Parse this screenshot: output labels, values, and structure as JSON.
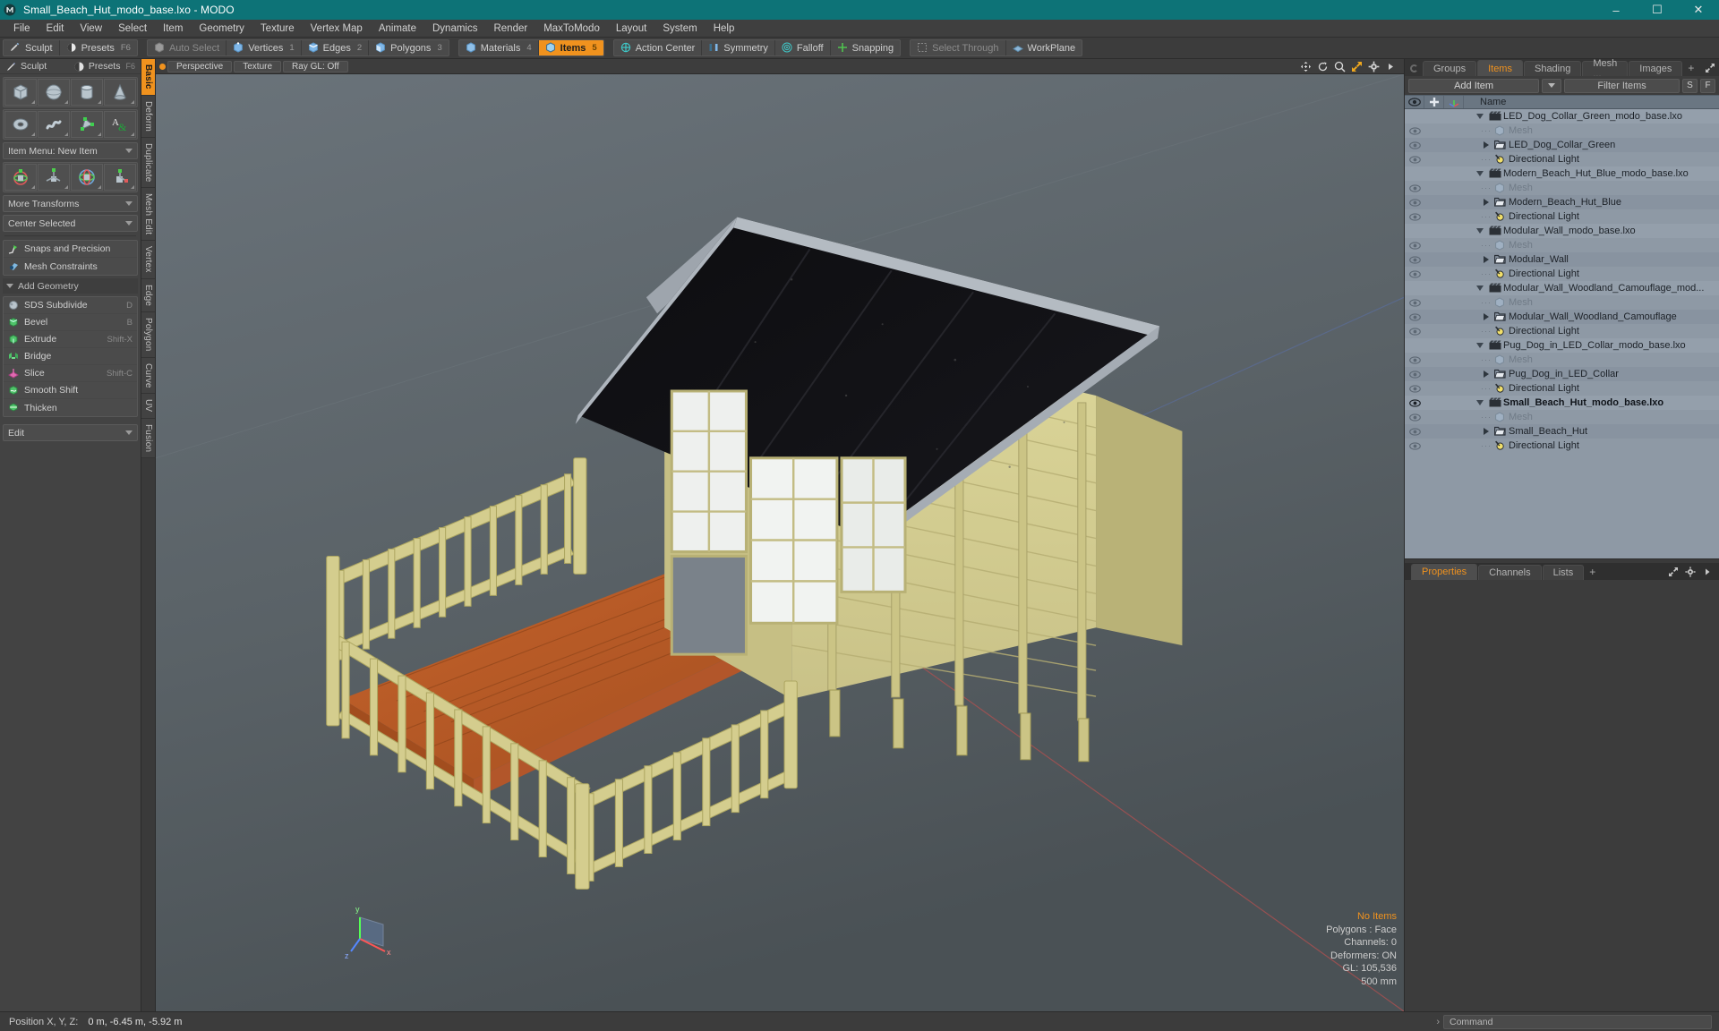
{
  "titlebar": {
    "title": "Small_Beach_Hut_modo_base.lxo - MODO",
    "minimize": "–",
    "maximize": "☐",
    "close": "✕"
  },
  "menubar": {
    "items": [
      "File",
      "Edit",
      "View",
      "Select",
      "Item",
      "Geometry",
      "Texture",
      "Vertex Map",
      "Animate",
      "Dynamics",
      "Render",
      "MaxToModo",
      "Layout",
      "System",
      "Help"
    ]
  },
  "modebar": {
    "group1": [
      {
        "label": "Sculpt",
        "icon": "sculpt-icon",
        "state": "normal",
        "num": ""
      },
      {
        "label": "Presets",
        "icon": "presets-icon",
        "state": "normal",
        "num": "F6"
      }
    ],
    "group2": [
      {
        "label": "Auto Select",
        "icon": "auto-select-icon",
        "state": "dim",
        "num": ""
      },
      {
        "label": "Vertices",
        "icon": "vertices-icon",
        "state": "normal",
        "num": "1"
      },
      {
        "label": "Edges",
        "icon": "edges-icon",
        "state": "normal",
        "num": "2"
      },
      {
        "label": "Polygons",
        "icon": "polygons-icon",
        "state": "normal",
        "num": "3"
      }
    ],
    "group3": [
      {
        "label": "Materials",
        "icon": "materials-icon",
        "state": "normal",
        "num": "4"
      },
      {
        "label": "Items",
        "icon": "items-icon",
        "state": "active",
        "num": "5"
      }
    ],
    "group4": [
      {
        "label": "Action Center",
        "icon": "action-center-icon",
        "state": "normal",
        "num": ""
      },
      {
        "label": "Symmetry",
        "icon": "symmetry-icon",
        "state": "normal",
        "num": ""
      },
      {
        "label": "Falloff",
        "icon": "falloff-icon",
        "state": "normal",
        "num": ""
      },
      {
        "label": "Snapping",
        "icon": "snapping-icon",
        "state": "normal",
        "num": ""
      }
    ],
    "group5": [
      {
        "label": "Select Through",
        "icon": "select-through-icon",
        "state": "dim",
        "num": ""
      },
      {
        "label": "WorkPlane",
        "icon": "workplane-icon",
        "state": "normal",
        "num": ""
      }
    ]
  },
  "left_panel": {
    "header": [
      {
        "label": "Sculpt",
        "icon": "sculpt-icon",
        "key": ""
      },
      {
        "label": "Presets",
        "icon": "presets-icon",
        "key": "F6"
      }
    ],
    "primitives_row1": [
      "cube-icon",
      "sphere-icon",
      "cylinder-icon",
      "cone-icon"
    ],
    "primitives_row2": [
      "torus-icon",
      "spiral-icon",
      "polygon-pen-icon",
      "text-icon"
    ],
    "item_menu": "Item Menu: New Item",
    "transforms_row": [
      "transform-move-icon",
      "transform-position-icon",
      "transform-rotate-icon",
      "transform-scale-icon"
    ],
    "more_transforms": "More Transforms",
    "center_selected": "Center Selected",
    "snaps": {
      "label": "Snaps and Precision",
      "icon": "snaps-icon"
    },
    "constraints": {
      "label": "Mesh Constraints",
      "icon": "constraints-icon"
    },
    "add_geometry_header": "Add Geometry",
    "geometry_tools": [
      {
        "label": "SDS Subdivide",
        "shortcut": "D",
        "icon": "sds-icon"
      },
      {
        "label": "Bevel",
        "shortcut": "B",
        "icon": "bevel-icon"
      },
      {
        "label": "Extrude",
        "shortcut": "Shift-X",
        "icon": "extrude-icon"
      },
      {
        "label": "Bridge",
        "shortcut": "",
        "icon": "bridge-icon"
      },
      {
        "label": "Slice",
        "shortcut": "Shift-C",
        "icon": "slice-icon"
      },
      {
        "label": "Smooth Shift",
        "shortcut": "",
        "icon": "smooth-shift-icon"
      },
      {
        "label": "Thicken",
        "shortcut": "",
        "icon": "thicken-icon"
      }
    ],
    "edit_dropdown": "Edit",
    "vtabs": [
      {
        "label": "Basic",
        "active": true
      },
      {
        "label": "Deform",
        "active": false
      },
      {
        "label": "Duplicate",
        "active": false
      },
      {
        "label": "Mesh Edit",
        "active": false
      },
      {
        "label": "Vertex",
        "active": false
      },
      {
        "label": "Edge",
        "active": false
      },
      {
        "label": "Polygon",
        "active": false
      },
      {
        "label": "Curve",
        "active": false
      },
      {
        "label": "UV",
        "active": false
      },
      {
        "label": "Fusion",
        "active": false
      }
    ]
  },
  "viewport": {
    "buttons": [
      "Perspective",
      "Texture",
      "Ray GL: Off"
    ],
    "nav_icons": [
      "move-icon",
      "rotate-icon",
      "zoom-icon",
      "fit-icon",
      "gear-icon",
      "chevron-right-icon"
    ],
    "info": {
      "selection": "No Items",
      "polygons": "Polygons : Face",
      "channels": "Channels: 0",
      "deformers": "Deformers: ON",
      "gl": "GL: 105,536",
      "scale": "500 mm"
    },
    "axis_labels": {
      "x": "x",
      "y": "y",
      "z": "z"
    }
  },
  "right_panel": {
    "tabs": [
      {
        "label": "Groups",
        "active": false
      },
      {
        "label": "Items",
        "active": true
      },
      {
        "label": "Shading",
        "active": false
      },
      {
        "label": "Mesh ...",
        "active": false
      },
      {
        "label": "Images",
        "active": false
      }
    ],
    "tab_plus": "+",
    "tab_icons": [
      "expand-icon",
      "gear-icon",
      "chevron-right-icon"
    ],
    "toolbar": {
      "add_item": "Add Item",
      "filter_placeholder": "Filter Items",
      "s_button": "S",
      "f_button": "F"
    },
    "list_header": {
      "col_eye": "eye-icon",
      "col_lock": "lock-icon",
      "col_axis": "axis-icon",
      "name": "Name"
    },
    "items": [
      {
        "level": 0,
        "label": "LED_Dog_Collar_Green_modo_base.lxo",
        "icon": "scene-icon",
        "expander": "down",
        "eye": false,
        "dim": false,
        "bold": false
      },
      {
        "level": 1,
        "label": "Mesh",
        "icon": "mesh-icon",
        "expander": "none",
        "eye": true,
        "dim": true,
        "bold": false
      },
      {
        "level": 1,
        "label": "LED_Dog_Collar_Green",
        "icon": "group-icon",
        "expander": "right",
        "eye": true,
        "dim": false,
        "bold": false
      },
      {
        "level": 1,
        "label": "Directional Light",
        "icon": "light-icon",
        "expander": "none",
        "eye": true,
        "dim": false,
        "bold": false
      },
      {
        "level": 0,
        "label": "Modern_Beach_Hut_Blue_modo_base.lxo",
        "icon": "scene-icon",
        "expander": "down",
        "eye": false,
        "dim": false,
        "bold": false
      },
      {
        "level": 1,
        "label": "Mesh",
        "icon": "mesh-icon",
        "expander": "none",
        "eye": true,
        "dim": true,
        "bold": false
      },
      {
        "level": 1,
        "label": "Modern_Beach_Hut_Blue",
        "icon": "group-icon",
        "expander": "right",
        "eye": true,
        "dim": false,
        "bold": false
      },
      {
        "level": 1,
        "label": "Directional Light",
        "icon": "light-icon",
        "expander": "none",
        "eye": true,
        "dim": false,
        "bold": false
      },
      {
        "level": 0,
        "label": "Modular_Wall_modo_base.lxo",
        "icon": "scene-icon",
        "expander": "down",
        "eye": false,
        "dim": false,
        "bold": false
      },
      {
        "level": 1,
        "label": "Mesh",
        "icon": "mesh-icon",
        "expander": "none",
        "eye": true,
        "dim": true,
        "bold": false
      },
      {
        "level": 1,
        "label": "Modular_Wall",
        "icon": "group-icon",
        "expander": "right",
        "eye": true,
        "dim": false,
        "bold": false
      },
      {
        "level": 1,
        "label": "Directional Light",
        "icon": "light-icon",
        "expander": "none",
        "eye": true,
        "dim": false,
        "bold": false
      },
      {
        "level": 0,
        "label": "Modular_Wall_Woodland_Camouflage_mod...",
        "icon": "scene-icon",
        "expander": "down",
        "eye": false,
        "dim": false,
        "bold": false
      },
      {
        "level": 1,
        "label": "Mesh",
        "icon": "mesh-icon",
        "expander": "none",
        "eye": true,
        "dim": true,
        "bold": false
      },
      {
        "level": 1,
        "label": "Modular_Wall_Woodland_Camouflage",
        "icon": "group-icon",
        "expander": "right",
        "eye": true,
        "dim": false,
        "bold": false
      },
      {
        "level": 1,
        "label": "Directional Light",
        "icon": "light-icon",
        "expander": "none",
        "eye": true,
        "dim": false,
        "bold": false
      },
      {
        "level": 0,
        "label": "Pug_Dog_in_LED_Collar_modo_base.lxo",
        "icon": "scene-icon",
        "expander": "down",
        "eye": false,
        "dim": false,
        "bold": false
      },
      {
        "level": 1,
        "label": "Mesh",
        "icon": "mesh-icon",
        "expander": "none",
        "eye": true,
        "dim": true,
        "bold": false
      },
      {
        "level": 1,
        "label": "Pug_Dog_in_LED_Collar",
        "icon": "group-icon",
        "expander": "right",
        "eye": true,
        "dim": false,
        "bold": false
      },
      {
        "level": 1,
        "label": "Directional Light",
        "icon": "light-icon",
        "expander": "none",
        "eye": true,
        "dim": false,
        "bold": false
      },
      {
        "level": 0,
        "label": "Small_Beach_Hut_modo_base.lxo",
        "icon": "scene-icon",
        "expander": "down",
        "eye": true,
        "dim": false,
        "bold": true
      },
      {
        "level": 1,
        "label": "Mesh",
        "icon": "mesh-icon",
        "expander": "none",
        "eye": true,
        "dim": true,
        "bold": false
      },
      {
        "level": 1,
        "label": "Small_Beach_Hut",
        "icon": "group-icon",
        "expander": "right",
        "eye": true,
        "dim": false,
        "bold": false
      },
      {
        "level": 1,
        "label": "Directional Light",
        "icon": "light-icon",
        "expander": "none",
        "eye": true,
        "dim": false,
        "bold": false
      }
    ],
    "properties_tabs": [
      {
        "label": "Properties",
        "active": true
      },
      {
        "label": "Channels",
        "active": false
      },
      {
        "label": "Lists",
        "active": false
      }
    ],
    "properties_plus": "+",
    "properties_icons": [
      "expand-icon",
      "gear-icon",
      "chevron-right-icon"
    ]
  },
  "statusbar": {
    "position_label": "Position X, Y, Z:",
    "position_value": "0 m,  -6.45 m,  -5.92 m",
    "command_placeholder": "Command",
    "chevron": "›"
  },
  "colors": {
    "accent": "#f0921e",
    "titlebar": "#0d7377",
    "panel": "#3c3c3c",
    "list_bg": "#8e99a5",
    "list_header": "#6a7682"
  }
}
